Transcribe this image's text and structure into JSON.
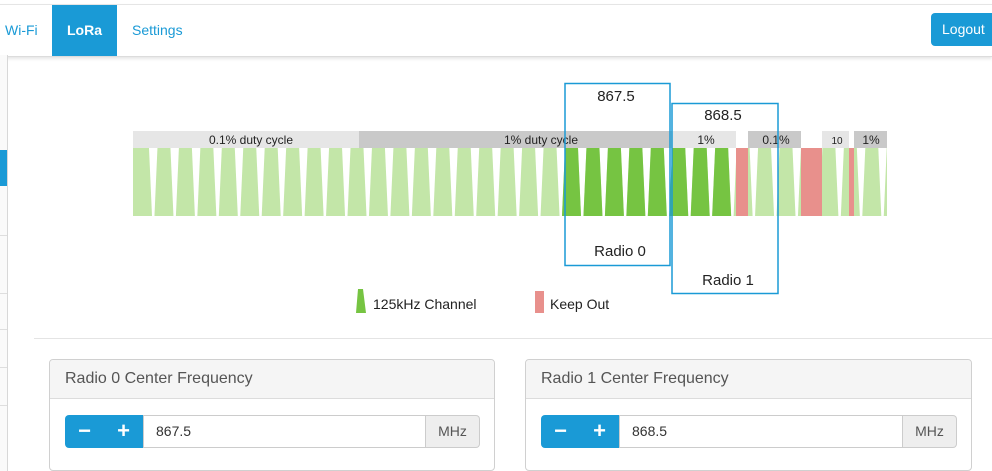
{
  "nav": {
    "tabs": [
      {
        "label": "Wi-Fi",
        "active": false
      },
      {
        "label": "LoRa",
        "active": true
      },
      {
        "label": "Settings",
        "active": false
      }
    ],
    "logout_label": "Logout"
  },
  "spectrum": {
    "duty_labels": [
      "0.1% duty cycle",
      "1% duty cycle",
      "1%",
      "0.1%",
      "10",
      "1%"
    ],
    "radio0": {
      "frequency": "867.5",
      "label": "Radio 0"
    },
    "radio1": {
      "frequency": "868.5",
      "label": "Radio 1"
    }
  },
  "legend": {
    "channel": "125kHz Channel",
    "keep_out": "Keep Out"
  },
  "panels": [
    {
      "title": "Radio 0 Center Frequency",
      "minus": "−",
      "plus": "+",
      "value": "867.5",
      "unit": "MHz"
    },
    {
      "title": "Radio 1 Center Frequency",
      "minus": "−",
      "plus": "+",
      "value": "868.5",
      "unit": "MHz"
    }
  ],
  "colors": {
    "accent": "#1a9ad6",
    "channel_light": "#c3e6a8",
    "channel_active": "#76c442",
    "keep_out": "#e8908c"
  }
}
